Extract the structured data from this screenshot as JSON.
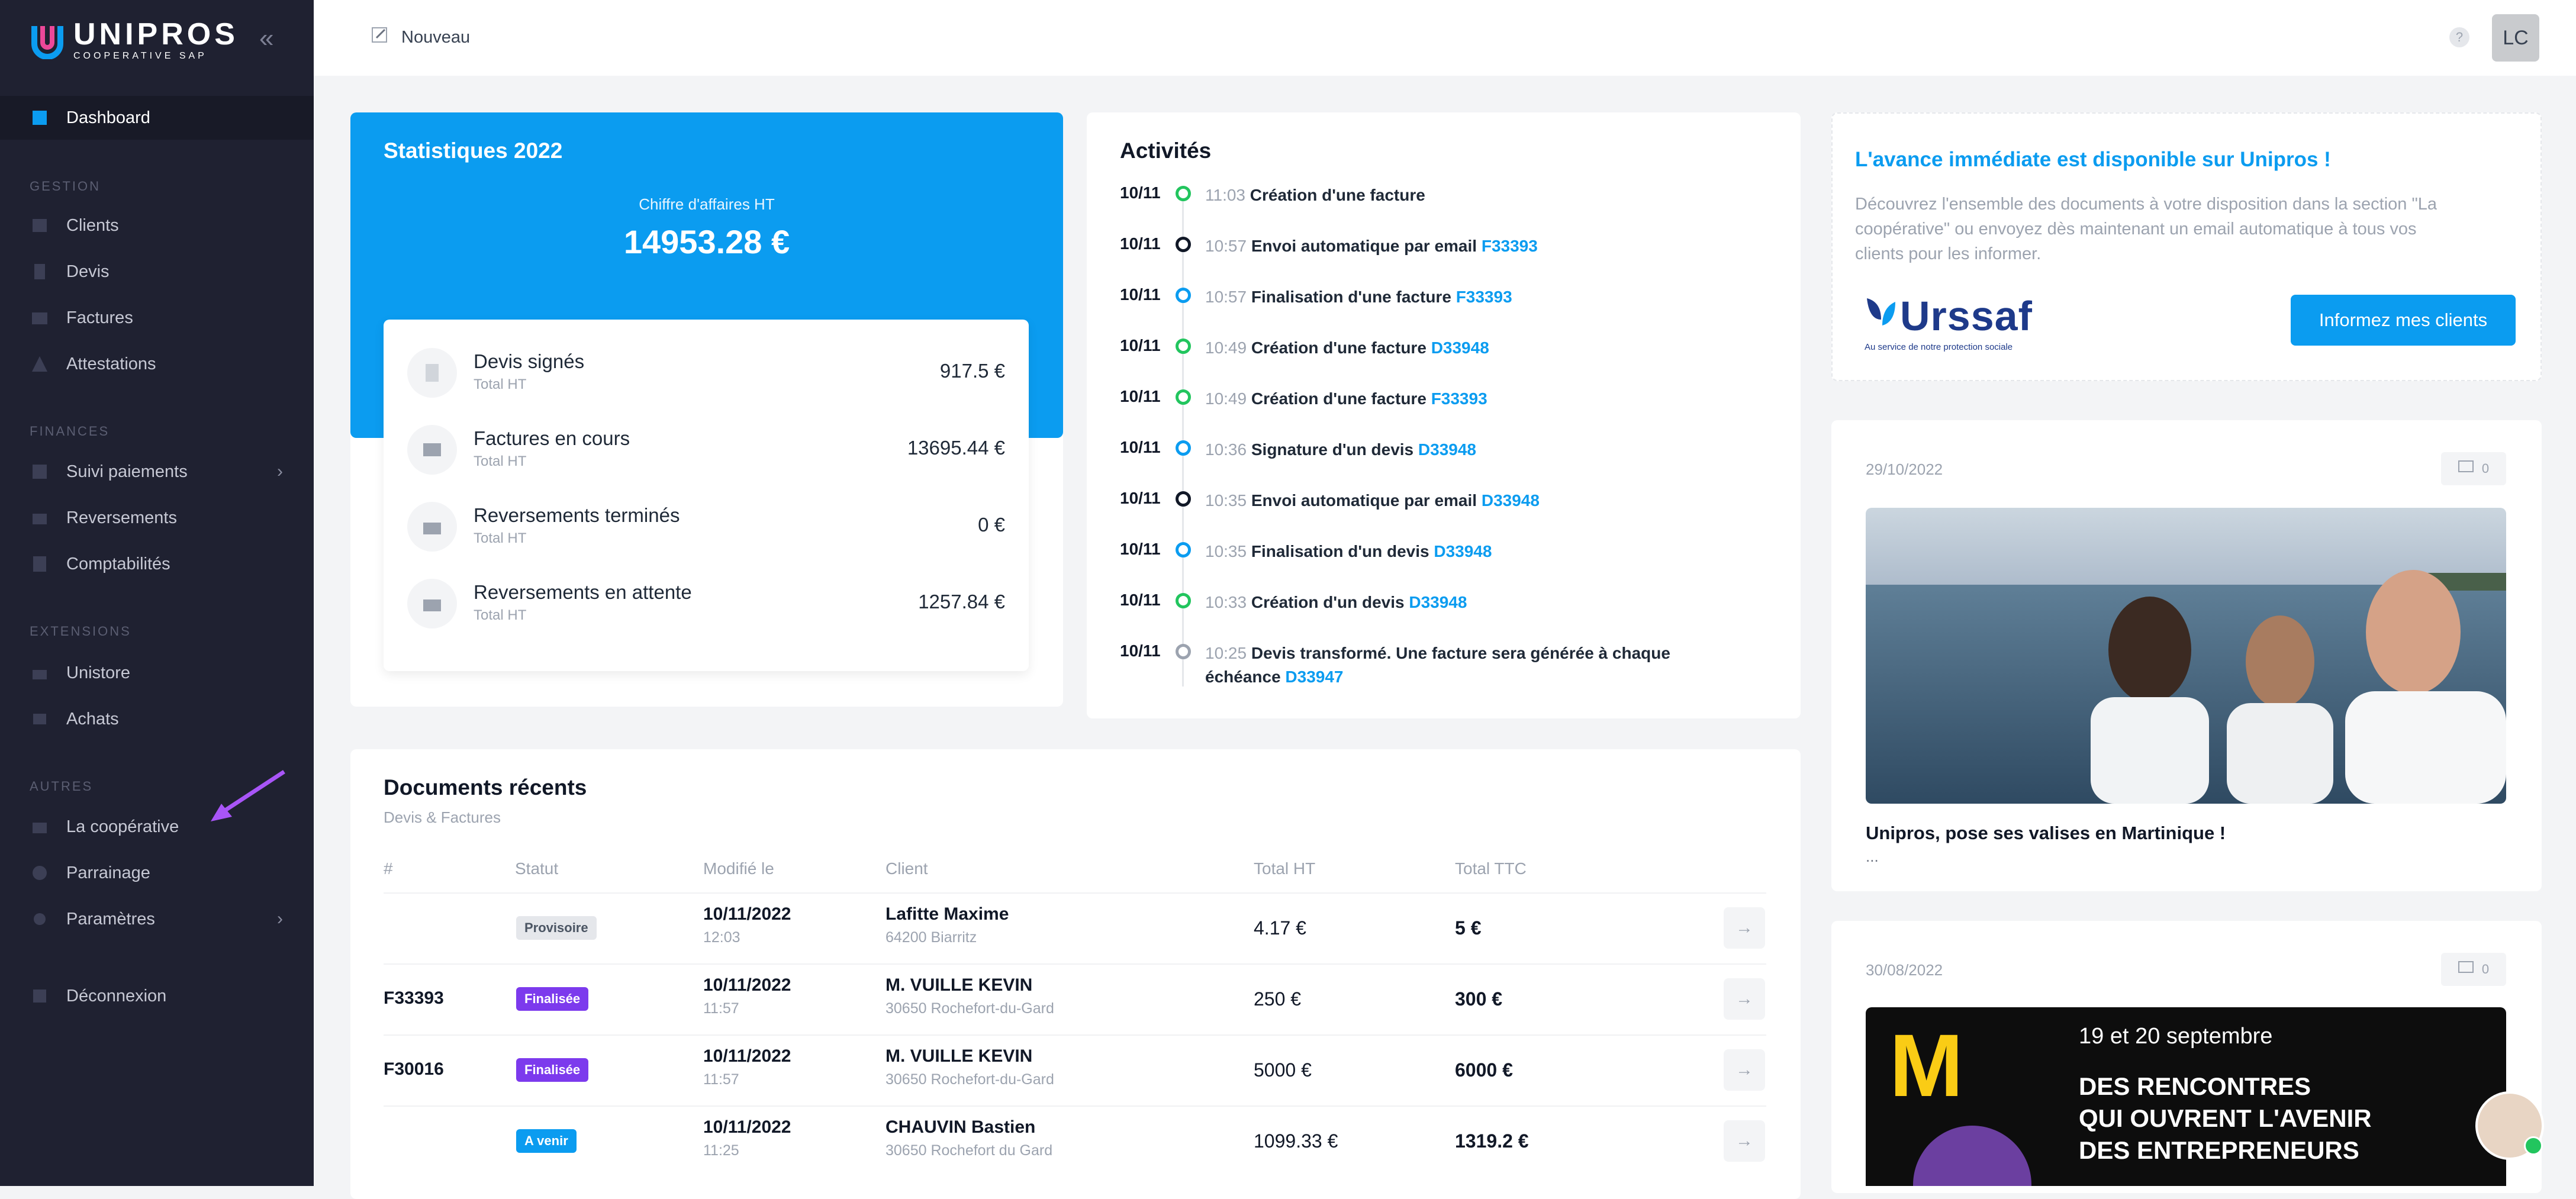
{
  "brand": {
    "name": "UNIPROS",
    "subtitle": "COOPERATIVE SAP",
    "color": "#0b9cf0"
  },
  "sidebar": {
    "collapse_icon": "double-chevron-left-icon",
    "sections": {
      "gestion": "GESTION",
      "finances": "FINANCES",
      "extensions": "EXTENSIONS",
      "autres": "AUTRES"
    },
    "items": {
      "dashboard": "Dashboard",
      "clients": "Clients",
      "devis": "Devis",
      "factures": "Factures",
      "attestations": "Attestations",
      "suivi": "Suivi paiements",
      "reversements": "Reversements",
      "comptabilites": "Comptabilités",
      "unistore": "Unistore",
      "achats": "Achats",
      "cooperative": "La coopérative",
      "parrainage": "Parrainage",
      "parametres": "Paramètres",
      "deconnexion": "Déconnexion"
    }
  },
  "topbar": {
    "new_label": "Nouveau",
    "help": "?",
    "avatar": "LC"
  },
  "stats": {
    "title": "Statistiques 2022",
    "ca_label": "Chiffre d'affaires HT",
    "ca_value": "14953.28 €",
    "rows": [
      {
        "name": "Devis signés",
        "sub": "Total HT",
        "value": "917.5 €"
      },
      {
        "name": "Factures en cours",
        "sub": "Total HT",
        "value": "13695.44 €"
      },
      {
        "name": "Reversements terminés",
        "sub": "Total HT",
        "value": "0 €"
      },
      {
        "name": "Reversements en attente",
        "sub": "Total HT",
        "value": "1257.84 €"
      }
    ]
  },
  "activities": {
    "title": "Activités",
    "items": [
      {
        "date": "10/11",
        "time": "11:03",
        "text": "Création d'une facture",
        "link": "",
        "color": "#22c55e"
      },
      {
        "date": "10/11",
        "time": "10:57",
        "text": "Envoi automatique par email",
        "link": "F33393",
        "color": "#111827"
      },
      {
        "date": "10/11",
        "time": "10:57",
        "text": "Finalisation d'une facture",
        "link": "F33393",
        "color": "#0b9cf0"
      },
      {
        "date": "10/11",
        "time": "10:49",
        "text": "Création d'une facture",
        "link": "D33948",
        "color": "#22c55e"
      },
      {
        "date": "10/11",
        "time": "10:49",
        "text": "Création d'une facture",
        "link": "F33393",
        "color": "#22c55e"
      },
      {
        "date": "10/11",
        "time": "10:36",
        "text": "Signature d'un devis",
        "link": "D33948",
        "color": "#0b9cf0"
      },
      {
        "date": "10/11",
        "time": "10:35",
        "text": "Envoi automatique par email",
        "link": "D33948",
        "color": "#111827"
      },
      {
        "date": "10/11",
        "time": "10:35",
        "text": "Finalisation d'un devis",
        "link": "D33948",
        "color": "#0b9cf0"
      },
      {
        "date": "10/11",
        "time": "10:33",
        "text": "Création d'un devis",
        "link": "D33948",
        "color": "#22c55e"
      },
      {
        "date": "10/11",
        "time": "10:25",
        "text": "Devis transformé. Une facture sera générée à chaque échéance",
        "link": "D33947",
        "color": "#9ca3af"
      }
    ]
  },
  "promo": {
    "title": "L'avance immédiate est disponible sur Unipros !",
    "text": "Découvrez l'ensemble des documents à votre disposition dans la section \"La coopérative\" ou envoyez dès maintenant un email automatique à tous vos clients pour les informer.",
    "button": "Informez mes clients",
    "urssaf_word": "Urssaf",
    "urssaf_tag": "Au service de notre protection sociale"
  },
  "news": [
    {
      "date": "29/10/2022",
      "comments": "0",
      "title": "Unipros, pose ses valises en Martinique !",
      "excerpt": "..."
    },
    {
      "date": "30/08/2022",
      "comments": "0",
      "poster_date": "19 et 20 septembre",
      "poster_l1": "DES RENCONTRES",
      "poster_l2": "QUI OUVRENT L'AVENIR",
      "poster_l3": "DES ENTREPRENEURS",
      "poster_letter": "M"
    }
  ],
  "docs": {
    "title": "Documents récents",
    "subtitle": "Devis & Factures",
    "headers": {
      "num": "#",
      "status": "Statut",
      "modified": "Modifié le",
      "client": "Client",
      "ht": "Total HT",
      "ttc": "Total TTC"
    },
    "rows": [
      {
        "num": "",
        "status": "Provisoire",
        "date": "10/11/2022",
        "time": "12:03",
        "client": "Lafitte Maxime",
        "address": "64200 Biarritz",
        "ht": "4.17 €",
        "ttc": "5 €"
      },
      {
        "num": "F33393",
        "status": "Finalisée",
        "date": "10/11/2022",
        "time": "11:57",
        "client": "M. VUILLE KEVIN",
        "address": "30650 Rochefort-du-Gard",
        "ht": "250 €",
        "ttc": "300 €"
      },
      {
        "num": "F30016",
        "status": "Finalisée",
        "date": "10/11/2022",
        "time": "11:57",
        "client": "M. VUILLE KEVIN",
        "address": "30650 Rochefort-du-Gard",
        "ht": "5000 €",
        "ttc": "6000 €"
      },
      {
        "num": "",
        "status": "A venir",
        "date": "10/11/2022",
        "time": "11:25",
        "client": "CHAUVIN Bastien",
        "address": "30650 Rochefort du Gard",
        "ht": "1099.33 €",
        "ttc": "1319.2 €"
      }
    ],
    "arrow": "→"
  }
}
